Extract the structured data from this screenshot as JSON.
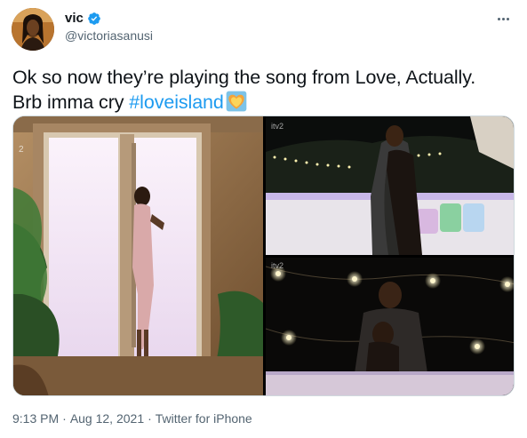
{
  "author": {
    "display_name": "vic",
    "handle": "@victoriasanusi",
    "verified": true,
    "avatar_icon": "profile-photo"
  },
  "tweet": {
    "text_line1": "Ok so now they’re playing the song from Love, Actually.",
    "text_line2_prefix": "Brb imma cry ",
    "hashtag": "#loveisland",
    "emoji": "heart-on-fire-emoji"
  },
  "media": {
    "count": 3,
    "images": [
      {
        "name": "villa-door-photo"
      },
      {
        "name": "couple-terrace-photo"
      },
      {
        "name": "couple-lights-photo"
      }
    ],
    "watermark": "itv2"
  },
  "meta": {
    "time": "9:13 PM",
    "date": "Aug 12, 2021",
    "source": "Twitter for iPhone",
    "separator": "·"
  },
  "colors": {
    "text": "#0f1419",
    "secondary": "#536471",
    "link": "#1d9bf0",
    "verified": "#1d9bf0"
  }
}
